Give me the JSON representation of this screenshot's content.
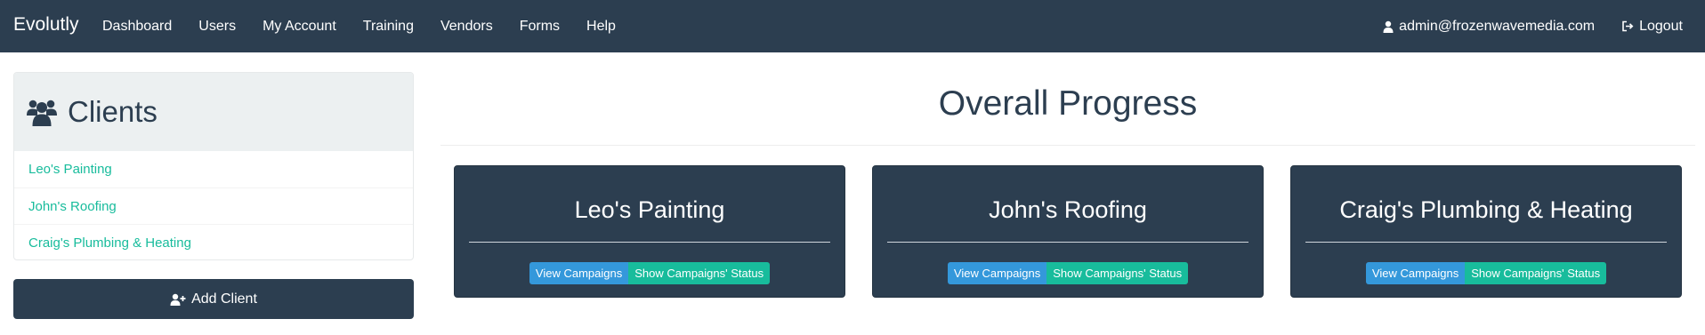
{
  "navbar": {
    "brand": "Evolutly",
    "links": [
      "Dashboard",
      "Users",
      "My Account",
      "Training",
      "Vendors",
      "Forms",
      "Help"
    ],
    "user_email": "admin@frozenwavemedia.com",
    "logout_label": "Logout"
  },
  "sidebar": {
    "title": "Clients",
    "clients": [
      "Leo's Painting",
      "John's Roofing",
      "Craig's Plumbing & Heating"
    ],
    "add_client_label": "Add Client"
  },
  "main": {
    "title": "Overall Progress",
    "cards": [
      {
        "name": "Leo's Painting",
        "view_label": "View Campaigns",
        "status_label": "Show Campaigns' Status"
      },
      {
        "name": "John's Roofing",
        "view_label": "View Campaigns",
        "status_label": "Show Campaigns' Status"
      },
      {
        "name": "Craig's Plumbing & Heating",
        "view_label": "View Campaigns",
        "status_label": "Show Campaigns' Status"
      }
    ]
  },
  "colors": {
    "navbar_bg": "#2c3e50",
    "link_green": "#18bc9c",
    "button_blue": "#3498db",
    "panel_heading_bg": "#ecf0f1"
  },
  "icons": {
    "user": "user-icon",
    "logout": "logout-icon",
    "clients": "users-group-icon",
    "add_client": "user-plus-icon"
  }
}
